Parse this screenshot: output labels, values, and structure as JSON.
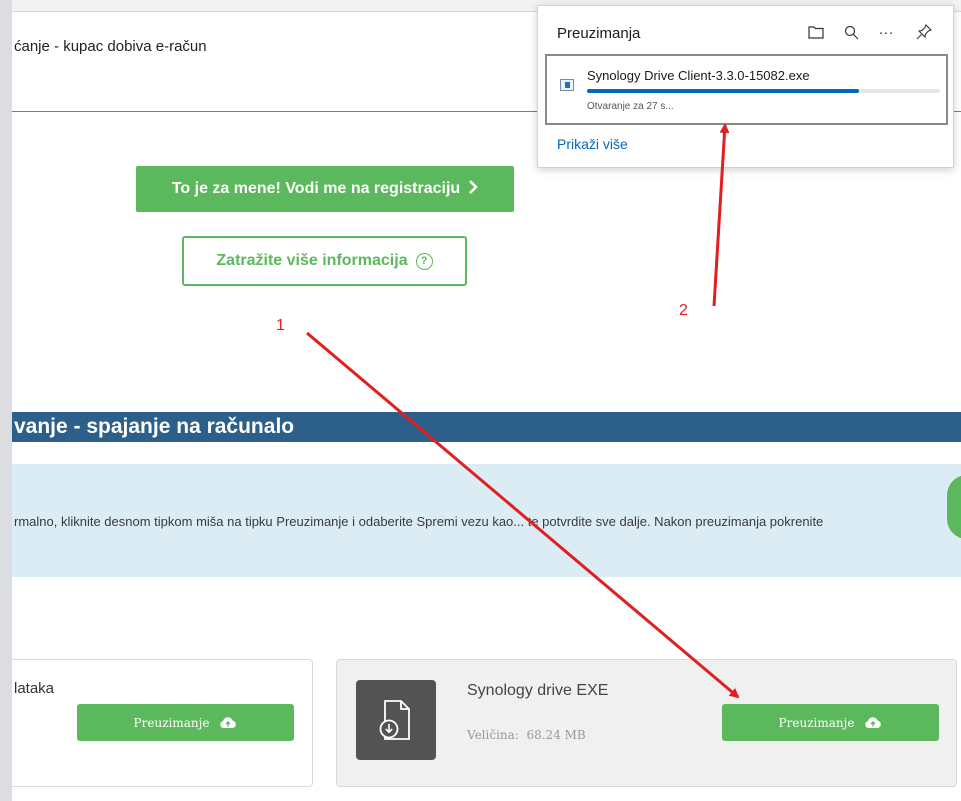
{
  "page": {
    "header_text": "ćanje - kupac dobiva e-račun",
    "register_button": "To je za mene! Vodi me na registraciju",
    "info_button": "Zatražite više informacija",
    "section_title": "vanje - spajanje na računalo",
    "instruction_text": "rmalno, kliknite desnom tipkom miša na tipku Preuzimanje i odaberite Spremi vezu kao... te potvrdite sve dalje. Nakon preuzimanja pokrenite"
  },
  "cards": {
    "left": {
      "title": "lataka",
      "button": "Preuzimanje"
    },
    "right": {
      "title": "Synology drive EXE",
      "size_label": "Veličina:",
      "size_value": "68.24 MB",
      "button": "Preuzimanje"
    }
  },
  "downloads_panel": {
    "title": "Preuzimanja",
    "icons": [
      "folder-icon",
      "search-icon",
      "more-icon",
      "pin-icon"
    ],
    "item": {
      "filename": "Synology Drive Client-3.3.0-15082.exe",
      "status": "Otvaranje za 27 s...",
      "progress": 0.77
    },
    "show_more": "Prikaži više"
  },
  "annotations": {
    "label_1": "1",
    "label_2": "2",
    "color": "#e02020"
  },
  "colors": {
    "green": "#5cb85c",
    "section_blue": "#2d5f8b",
    "info_band": "#dcecf5",
    "progress_blue": "#0067c0"
  }
}
